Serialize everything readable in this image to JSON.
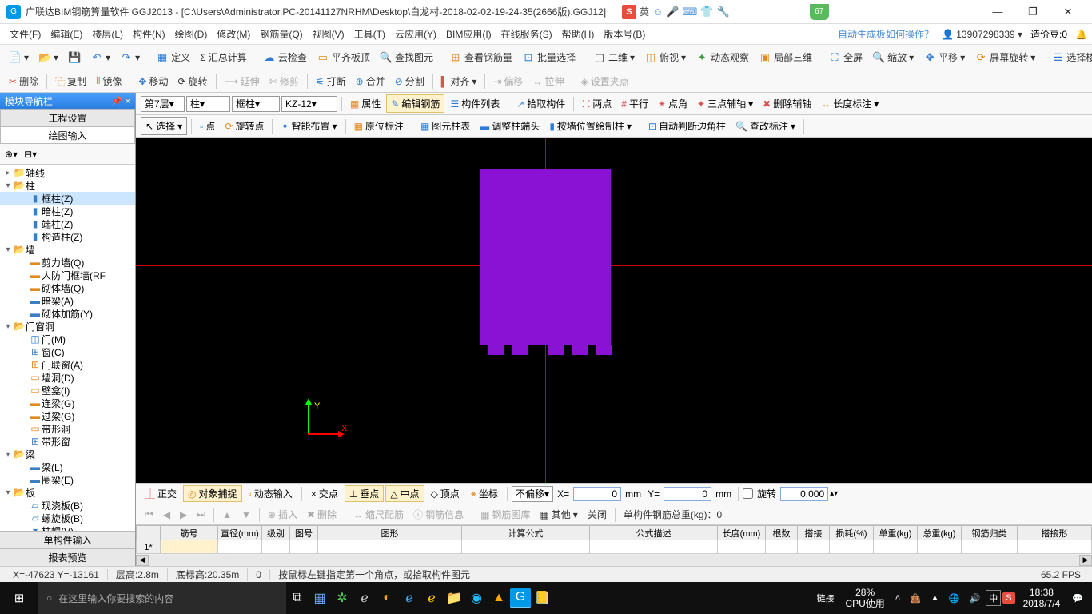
{
  "title": "广联达BIM钢筋算量软件 GGJ2013 - [C:\\Users\\Administrator.PC-20141127NRHM\\Desktop\\白龙村-2018-02-02-19-24-35(2666版).GGJ12]",
  "ime": {
    "s": "S",
    "lang": "英",
    "icons": [
      "☺",
      "🎤",
      "⌨",
      "👕",
      "🔧"
    ]
  },
  "badge": "67",
  "winbtns": {
    "min": "—",
    "max": "❐",
    "close": "✕"
  },
  "menu": [
    "文件(F)",
    "编辑(E)",
    "楼层(L)",
    "构件(N)",
    "绘图(D)",
    "修改(M)",
    "钢筋量(Q)",
    "视图(V)",
    "工具(T)",
    "云应用(Y)",
    "BIM应用(I)",
    "在线服务(S)",
    "帮助(H)",
    "版本号(B)"
  ],
  "menu_tip": "自动生成板如何操作？",
  "user": "13907298339",
  "credits_lbl": "造价豆:0",
  "tb1": {
    "define": "定义",
    "sum": "Σ 汇总计算",
    "cloud": "云检查",
    "flat": "平齐板顶",
    "findg": "查找图元",
    "viewR": "查看钢筋量",
    "batch": "批量选择",
    "v2d": "二维",
    "bird": "俯视",
    "dyn": "动态观察",
    "local3d": "局部三维",
    "full": "全屏",
    "zoom": "缩放",
    "pan": "平移",
    "rot": "屏幕旋转",
    "floor": "选择楼层"
  },
  "tb2": {
    "del": "删除",
    "copy": "复制",
    "mirror": "镜像",
    "move": "移动",
    "rotate": "旋转",
    "extend": "延伸",
    "trim": "修剪",
    "break": "打断",
    "merge": "合并",
    "split": "分割",
    "align": "对齐",
    "offset": "偏移",
    "stretch": "拉伸",
    "grip": "设置夹点"
  },
  "ctx": {
    "floor": "第7层",
    "type": "柱",
    "subtype": "框柱",
    "code": "KZ-12",
    "attr": "属性",
    "editR": "编辑钢筋",
    "list": "构件列表",
    "pick": "拾取构件",
    "two": "两点",
    "para": "平行",
    "ang": "点角",
    "three": "三点辅轴",
    "delaux": "删除辅轴",
    "dim": "长度标注"
  },
  "ctx2": {
    "select": "选择",
    "point": "点",
    "rotpt": "旋转点",
    "smart": "智能布置",
    "origin": "原位标注",
    "coltab": "图元柱表",
    "adjust": "调整柱端头",
    "posdraw": "按墙位置绘制柱",
    "autoedge": "自动判断边角柱",
    "chkann": "查改标注"
  },
  "nav": {
    "title": "模块导航栏",
    "tab1": "工程设置",
    "tab2": "绘图输入",
    "g_axis": "轴线",
    "g_col": "柱",
    "col_items": [
      "框柱(Z)",
      "暗柱(Z)",
      "端柱(Z)",
      "构造柱(Z)"
    ],
    "g_wall": "墙",
    "wall_items": [
      "剪力墙(Q)",
      "人防门框墙(RF",
      "砌体墙(Q)",
      "暗梁(A)",
      "砌体加筋(Y)"
    ],
    "g_open": "门窗洞",
    "open_items": [
      "门(M)",
      "窗(C)",
      "门联窗(A)",
      "墙洞(D)",
      "壁龛(I)",
      "连梁(G)",
      "过梁(G)",
      "带形洞",
      "带形窗"
    ],
    "g_beam": "梁",
    "beam_items": [
      "梁(L)",
      "圈梁(E)"
    ],
    "g_slab": "板",
    "slab_items": [
      "现浇板(B)",
      "螺旋板(B)",
      "柱帽(V)"
    ],
    "btm1": "单构件输入",
    "btm2": "报表预览"
  },
  "snap": {
    "ortho": "正交",
    "osnap": "对象捕捉",
    "dynin": "动态输入",
    "cross": "交点",
    "perp": "垂点",
    "mid": "中点",
    "apex": "顶点",
    "coord": "坐标",
    "noofs": "不偏移",
    "xlbl": "X=",
    "xval": "0",
    "mm": "mm",
    "ylbl": "Y=",
    "yval": "0",
    "rot": "旋转",
    "rotval": "0.000"
  },
  "gtool": {
    "insert": "插入",
    "del": "删除",
    "scale": "缩尺配筋",
    "info": "钢筋信息",
    "lib": "钢筋图库",
    "other": "其他",
    "close": "关闭",
    "weight": "单构件钢筋总重(kg)：0"
  },
  "cols": [
    "筋号",
    "直径(mm)",
    "级别",
    "图号",
    "图形",
    "计算公式",
    "公式描述",
    "长度(mm)",
    "根数",
    "搭接",
    "损耗(%)",
    "单重(kg)",
    "总重(kg)",
    "钢筋归类",
    "搭接形"
  ],
  "row1": "1*",
  "status": {
    "xy": "X=-47623 Y=-13161",
    "h": "层高:2.8m",
    "bh": "底标高:20.35m",
    "o": "0",
    "msg": "按鼠标左键指定第一个角点，或拾取构件图元",
    "fps": "65.2 FPS"
  },
  "task": {
    "search": "在这里输入你要搜索的内容",
    "link": "链接",
    "cpu1": "28%",
    "cpu2": "CPU使用",
    "ime_zh": "中",
    "ime_s": "S",
    "time": "18:38",
    "date": "2018/7/4"
  },
  "axis": {
    "y": "Y",
    "x": "X"
  }
}
